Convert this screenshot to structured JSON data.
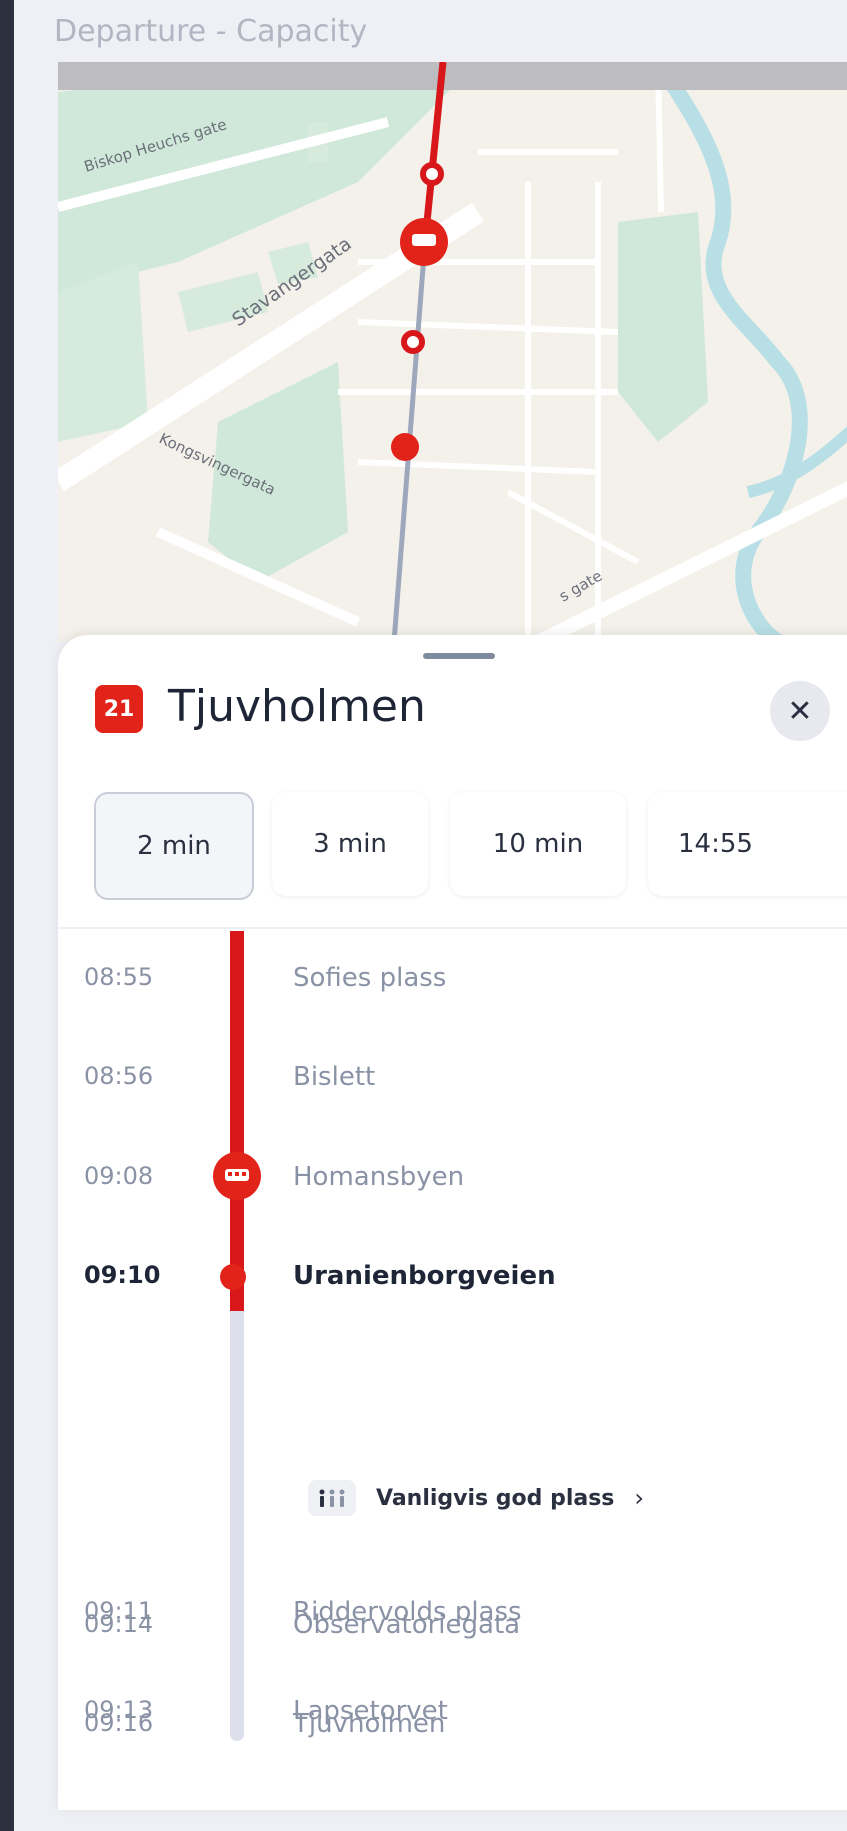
{
  "window_title": "Departure - Capacity",
  "map": {
    "street_labels": [
      "Biskop Heuchs gate",
      "Stavangergata",
      "Kongsvingergata",
      "s gate"
    ]
  },
  "colors": {
    "accent": "#e2231a",
    "track_inactive": "#dde0ea",
    "text_primary": "#1e2536",
    "text_muted": "#8a92a5"
  },
  "route": {
    "number": "21",
    "destination": "Tjuvholmen",
    "close_icon": "close-icon"
  },
  "departures": [
    "2 min",
    "3 min",
    "10 min",
    "14:55"
  ],
  "selected_departure": "2 min",
  "stops": [
    {
      "time": "08:55",
      "name": "Sofies plass"
    },
    {
      "time": "08:56",
      "name": "Bislett"
    },
    {
      "time": "09:08",
      "name": "Homansbyen"
    },
    {
      "time": "09:10",
      "name": "Uranienborgveien"
    },
    {
      "time": "09:11",
      "name": "Riddervolds plass"
    },
    {
      "time": "09:13",
      "name": "Lapsetorvet"
    },
    {
      "time": "09:14",
      "name": "Observatoriegata"
    },
    {
      "time": "09:16",
      "name": "Tjuvholmen"
    }
  ],
  "vehicle_stop": "Homansbyen",
  "current_stop": "Uranienborgveien",
  "capacity": {
    "icon": "people-icon",
    "text": "Vanligvis god plass"
  }
}
